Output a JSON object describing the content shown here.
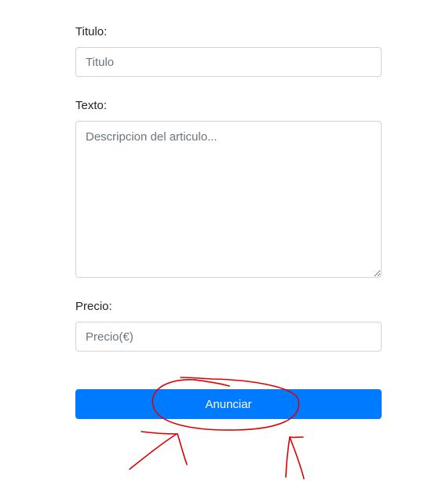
{
  "form": {
    "titulo": {
      "label": "Titulo:",
      "placeholder": "Titulo",
      "value": ""
    },
    "texto": {
      "label": "Texto:",
      "placeholder": "Descripcion del articulo...",
      "value": ""
    },
    "precio": {
      "label": "Precio:",
      "placeholder": "Precio(€)",
      "value": ""
    },
    "submit_label": "Anunciar"
  },
  "colors": {
    "primary_button": "#007bff",
    "annotation_red": "#e00000"
  }
}
